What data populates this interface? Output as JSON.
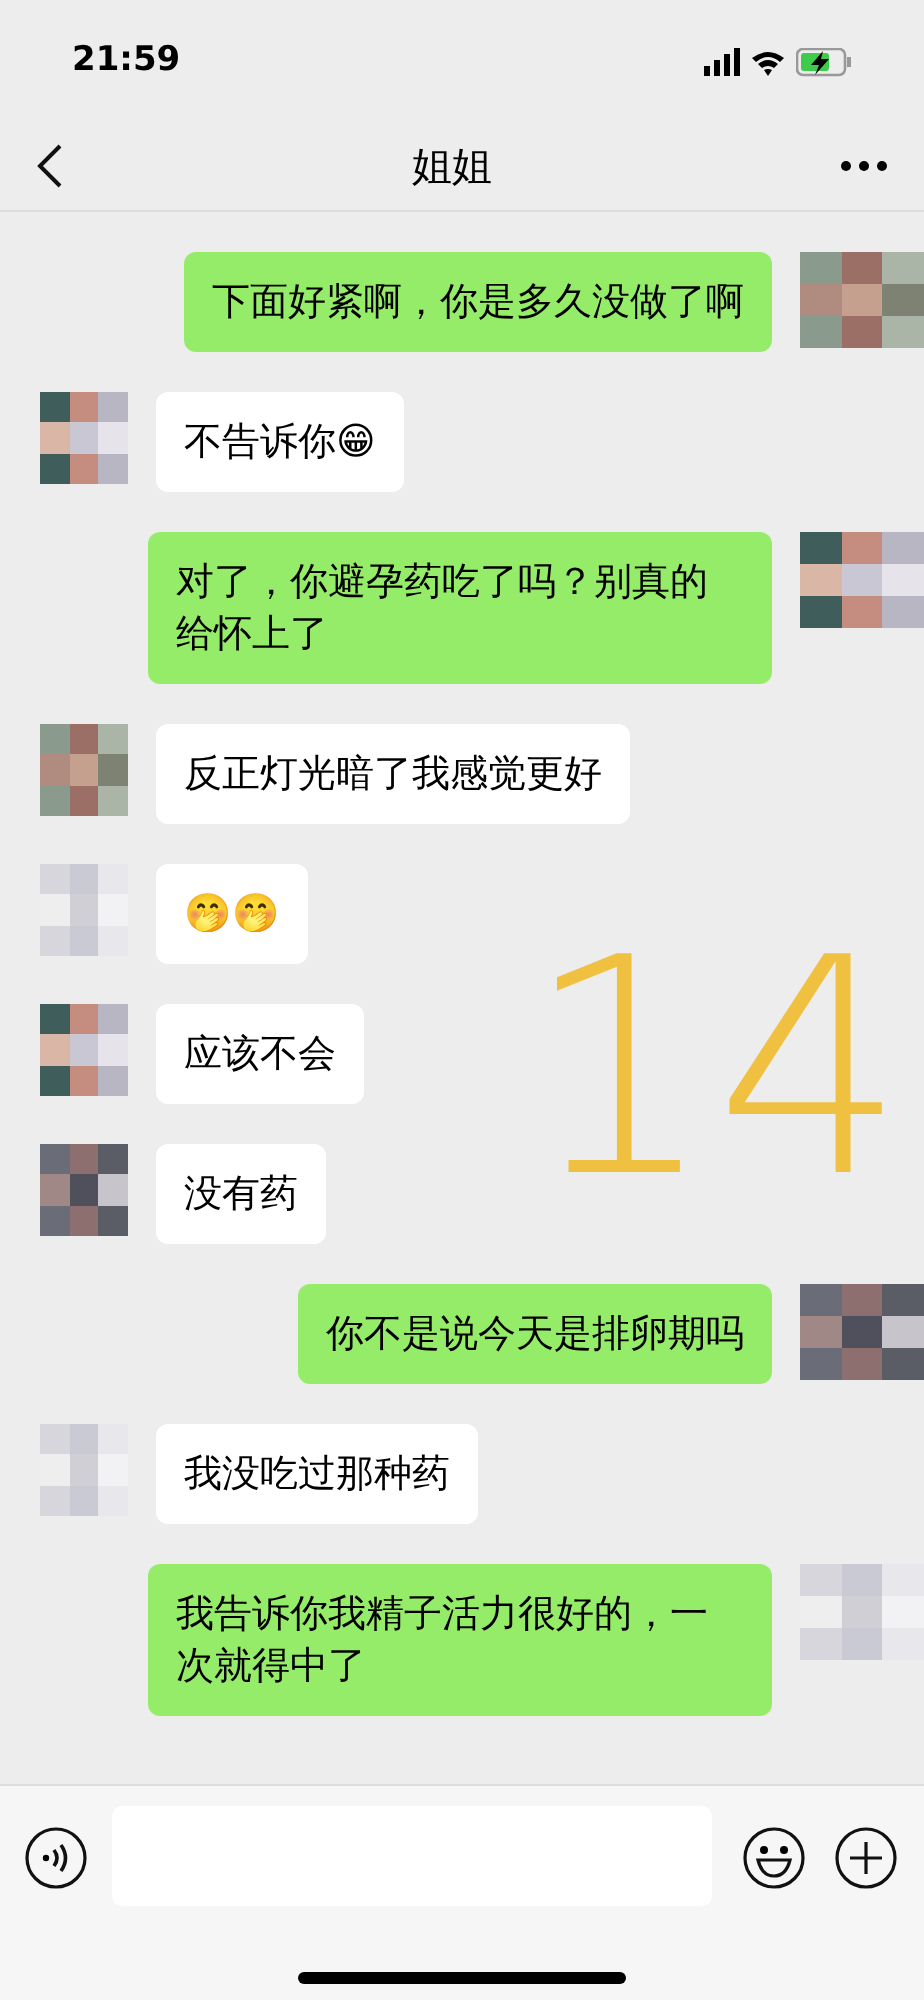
{
  "status_bar": {
    "time": "21:59"
  },
  "header": {
    "title": "姐姐"
  },
  "messages": [
    {
      "kind": "sent",
      "text": "下面好紧啊，你是多久没做了啊"
    },
    {
      "kind": "received",
      "text": "不告诉你😁"
    },
    {
      "kind": "sent",
      "text": "对了，你避孕药吃了吗？别真的给怀上了"
    },
    {
      "kind": "received",
      "text": "反正灯光暗了我感觉更好"
    },
    {
      "kind": "received",
      "text": "🤭🤭"
    },
    {
      "kind": "received",
      "text": "应该不会"
    },
    {
      "kind": "received",
      "text": "没有药"
    },
    {
      "kind": "sent",
      "text": "你不是说今天是排卵期吗"
    },
    {
      "kind": "received",
      "text": "我没吃过那种药"
    },
    {
      "kind": "sent",
      "text": "我告诉你我精子活力很好的，一次就得中了"
    }
  ],
  "annotation": {
    "text": "14"
  }
}
